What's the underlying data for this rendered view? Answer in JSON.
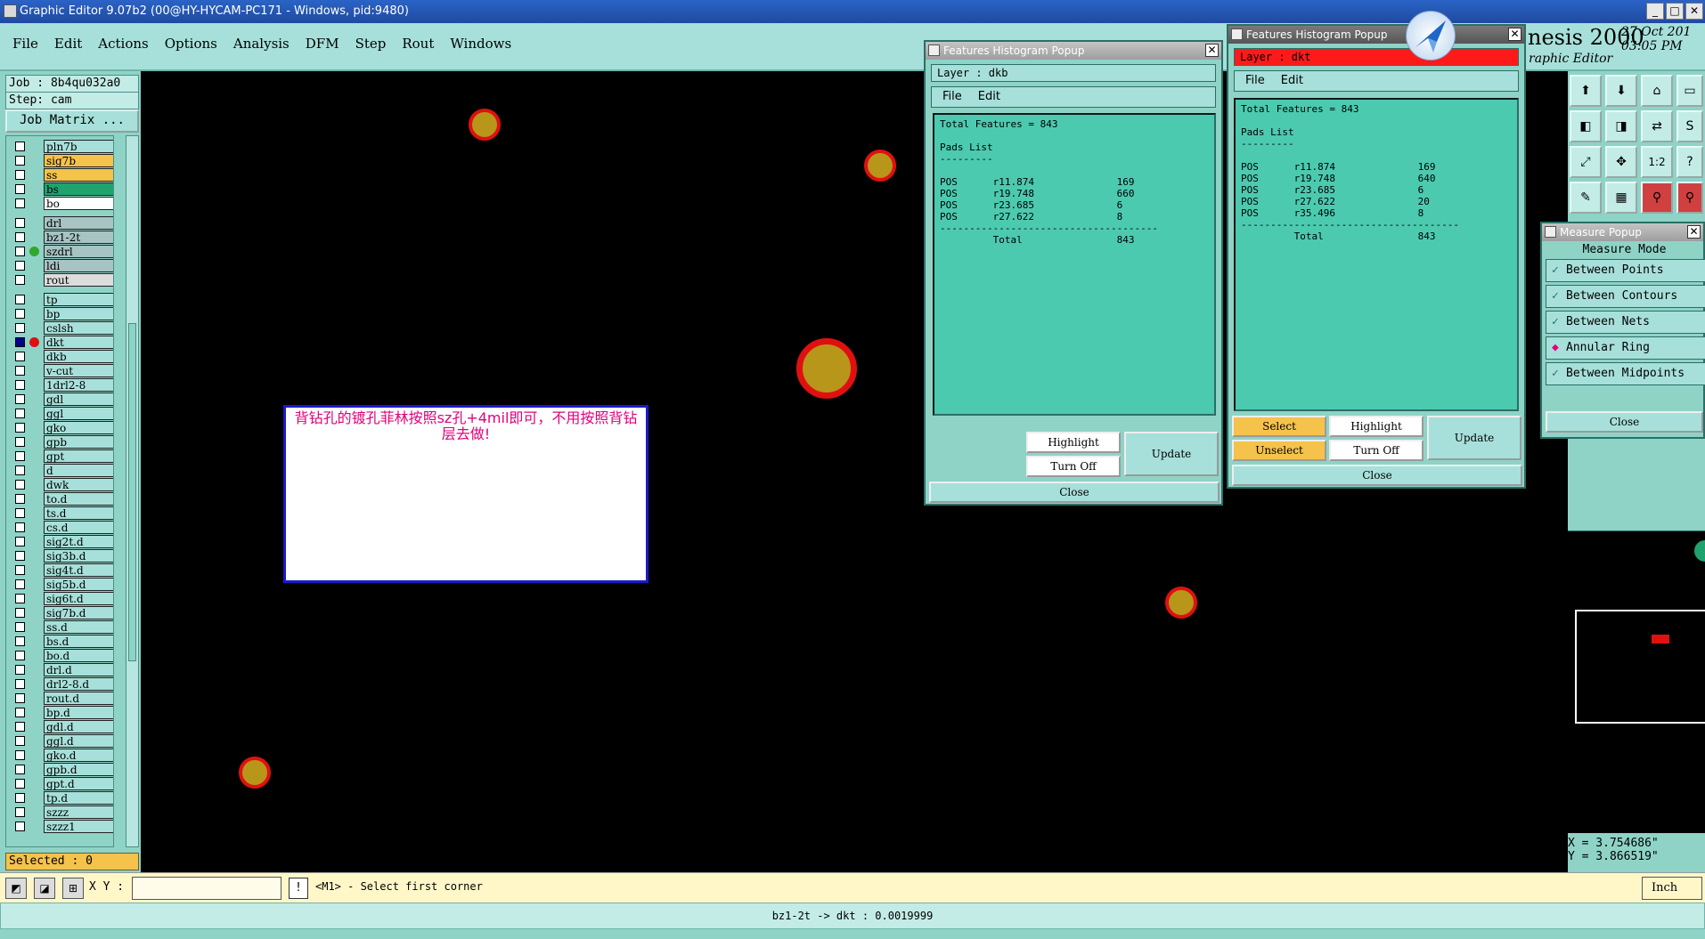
{
  "window": {
    "title": "Graphic Editor 9.07b2 (00@HY-HYCAM-PC171 - Windows, pid:9480)",
    "controls": [
      "_",
      "□",
      "✕"
    ]
  },
  "menubar": {
    "items": [
      "File",
      "Edit",
      "Actions",
      "Options",
      "Analysis",
      "DFM",
      "Step",
      "Rout",
      "Windows"
    ],
    "brand": "nesis 2000",
    "brand_sub": "raphic Editor",
    "date": "27 Oct 201",
    "time": "03:05 PM"
  },
  "left_panel": {
    "job": "Job : 8b4qu032a0",
    "step": "Step: cam",
    "job_matrix_button": "Job Matrix ...",
    "layers": [
      {
        "name": "pln7b",
        "color": "#a7e0da",
        "checked": false,
        "dot": ""
      },
      {
        "name": "sig7b",
        "color": "#f5c24b",
        "checked": false,
        "dot": ""
      },
      {
        "name": "ss",
        "color": "#f5c24b",
        "checked": false,
        "dot": ""
      },
      {
        "name": "bs",
        "color": "#1ea36f",
        "checked": false,
        "dot": ""
      },
      {
        "name": "bo",
        "color": "#ffffff",
        "checked": false,
        "dot": ""
      },
      {
        "name": "drl",
        "color": "#a7c3c3",
        "checked": false,
        "dot": ""
      },
      {
        "name": "bz1-2t",
        "color": "#a7c3c3",
        "checked": false,
        "dot": ""
      },
      {
        "name": "szdrl",
        "color": "#a7c3c3",
        "checked": false,
        "dot": "#2fa82f"
      },
      {
        "name": "ldi",
        "color": "#a7c3c3",
        "checked": false,
        "dot": ""
      },
      {
        "name": "rout",
        "color": "#dcdcdc",
        "checked": false,
        "dot": ""
      },
      {
        "name": "tp",
        "color": "#a7e0da",
        "checked": false,
        "dot": ""
      },
      {
        "name": "bp",
        "color": "#a7e0da",
        "checked": false,
        "dot": ""
      },
      {
        "name": "cslsh",
        "color": "#a7e0da",
        "checked": false,
        "dot": ""
      },
      {
        "name": "dkt",
        "color": "#a7e0da",
        "checked": true,
        "dot": "#e01010"
      },
      {
        "name": "dkb",
        "color": "#a7e0da",
        "checked": false,
        "dot": ""
      },
      {
        "name": "v-cut",
        "color": "#a7e0da",
        "checked": false,
        "dot": ""
      },
      {
        "name": "1drl2-8",
        "color": "#a7e0da",
        "checked": false,
        "dot": ""
      },
      {
        "name": "gdl",
        "color": "#a7e0da",
        "checked": false,
        "dot": ""
      },
      {
        "name": "ggl",
        "color": "#a7e0da",
        "checked": false,
        "dot": ""
      },
      {
        "name": "gko",
        "color": "#a7e0da",
        "checked": false,
        "dot": ""
      },
      {
        "name": "gpb",
        "color": "#a7e0da",
        "checked": false,
        "dot": ""
      },
      {
        "name": "gpt",
        "color": "#a7e0da",
        "checked": false,
        "dot": ""
      },
      {
        "name": "d",
        "color": "#a7e0da",
        "checked": false,
        "dot": ""
      },
      {
        "name": "dwk",
        "color": "#a7e0da",
        "checked": false,
        "dot": ""
      },
      {
        "name": "to.d",
        "color": "#a7e0da",
        "checked": false,
        "dot": ""
      },
      {
        "name": "ts.d",
        "color": "#a7e0da",
        "checked": false,
        "dot": ""
      },
      {
        "name": "cs.d",
        "color": "#a7e0da",
        "checked": false,
        "dot": ""
      },
      {
        "name": "sig2t.d",
        "color": "#a7e0da",
        "checked": false,
        "dot": ""
      },
      {
        "name": "sig3b.d",
        "color": "#a7e0da",
        "checked": false,
        "dot": ""
      },
      {
        "name": "sig4t.d",
        "color": "#a7e0da",
        "checked": false,
        "dot": ""
      },
      {
        "name": "sig5b.d",
        "color": "#a7e0da",
        "checked": false,
        "dot": ""
      },
      {
        "name": "sig6t.d",
        "color": "#a7e0da",
        "checked": false,
        "dot": ""
      },
      {
        "name": "sig7b.d",
        "color": "#a7e0da",
        "checked": false,
        "dot": ""
      },
      {
        "name": "ss.d",
        "color": "#a7e0da",
        "checked": false,
        "dot": ""
      },
      {
        "name": "bs.d",
        "color": "#a7e0da",
        "checked": false,
        "dot": ""
      },
      {
        "name": "bo.d",
        "color": "#a7e0da",
        "checked": false,
        "dot": ""
      },
      {
        "name": "drl.d",
        "color": "#a7e0da",
        "checked": false,
        "dot": ""
      },
      {
        "name": "drl2-8.d",
        "color": "#a7e0da",
        "checked": false,
        "dot": ""
      },
      {
        "name": "rout.d",
        "color": "#a7e0da",
        "checked": false,
        "dot": ""
      },
      {
        "name": "bp.d",
        "color": "#a7e0da",
        "checked": false,
        "dot": ""
      },
      {
        "name": "gdl.d",
        "color": "#a7e0da",
        "checked": false,
        "dot": ""
      },
      {
        "name": "ggl.d",
        "color": "#a7e0da",
        "checked": false,
        "dot": ""
      },
      {
        "name": "gko.d",
        "color": "#a7e0da",
        "checked": false,
        "dot": ""
      },
      {
        "name": "gpb.d",
        "color": "#a7e0da",
        "checked": false,
        "dot": ""
      },
      {
        "name": "gpt.d",
        "color": "#a7e0da",
        "checked": false,
        "dot": ""
      },
      {
        "name": "tp.d",
        "color": "#a7e0da",
        "checked": false,
        "dot": ""
      },
      {
        "name": "szzz",
        "color": "#a7e0da",
        "checked": false,
        "dot": ""
      },
      {
        "name": "szzz1",
        "color": "#a7e0da",
        "checked": false,
        "dot": ""
      }
    ],
    "selected": "Selected : 0"
  },
  "canvas": {
    "note": "背钻孔的镀孔菲林按照sz孔+4mil即可，不用按照背钻层去做!"
  },
  "popup_dkb": {
    "title": "Features Histogram Popup",
    "layer": "Layer :  dkb",
    "menu": [
      "File",
      "Edit"
    ],
    "report": "Total Features = 843\n\nPads List\n---------\n\nPOS      r11.874              169\nPOS      r19.748              660\nPOS      r23.685              6\nPOS      r27.622              8\n-------------------------------------\n         Total                843",
    "highlight": "Highlight",
    "turn_off": "Turn Off",
    "update": "Update",
    "close": "Close"
  },
  "popup_dkt": {
    "title": "Features Histogram Popup",
    "layer": "Layer :  dkt",
    "layer_color": "#ff1a1a",
    "menu": [
      "File",
      "Edit"
    ],
    "report": "Total Features = 843\n\nPads List\n---------\n\nPOS      r11.874              169\nPOS      r19.748              640\nPOS      r23.685              6\nPOS      r27.622              20\nPOS      r35.496              8\n-------------------------------------\n         Total                843",
    "select": "Select",
    "unselect": "Unselect",
    "highlight": "Highlight",
    "turn_off": "Turn Off",
    "update": "Update",
    "close": "Close"
  },
  "measure_popup": {
    "title": "Measure Popup",
    "mode_label": "Measure Mode",
    "options": [
      "Between Points",
      "Between Contours",
      "Between Nets",
      "Annular Ring",
      "Between Midpoints"
    ],
    "selected_index": 3,
    "close": "Close"
  },
  "coords": {
    "x": "X = 3.754686\"",
    "y": "Y = 3.866519\""
  },
  "bottom": {
    "xy_label": "X Y :",
    "xy_value": "",
    "bang": "!",
    "prompt": "<M1> - Select first corner",
    "units": "Inch"
  },
  "status": "bz1-2t -> dkt : 0.0019999"
}
